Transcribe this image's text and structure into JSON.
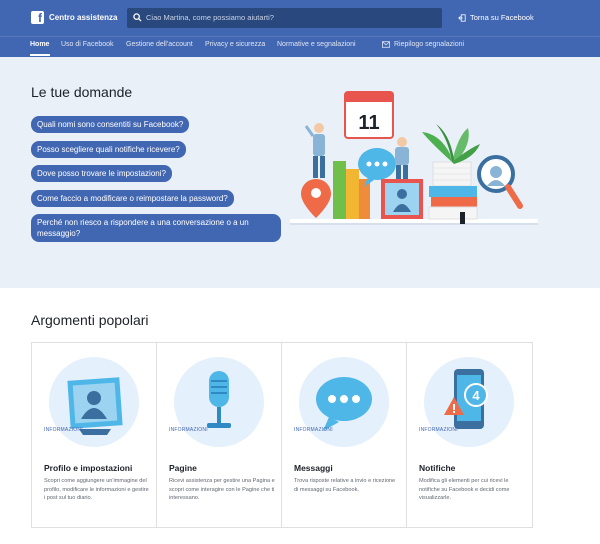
{
  "header": {
    "brand": "Centro assistenza",
    "logo_letter": "f",
    "search_placeholder": "Ciao Martina, come possiamo aiutarti?",
    "back_link": "Torna su Facebook"
  },
  "nav": {
    "items": [
      "Home",
      "Uso di Facebook",
      "Gestione dell'account",
      "Privacy e sicurezza",
      "Normative e segnalazioni"
    ],
    "report_label": "Riepilogo segnalazioni"
  },
  "hero": {
    "title": "Le tue domande",
    "questions": [
      "Quali nomi sono consentiti su Facebook?",
      "Posso scegliere quali notifiche ricevere?",
      "Dove posso trovare le impostazioni?",
      "Come faccio a modificare o reimpostare la password?",
      "Perché non riesco a rispondere a una conversazione o a un messaggio?"
    ],
    "calendar_day": "11"
  },
  "popular": {
    "title": "Argomenti popolari",
    "cards": [
      {
        "category": "INFORMAZIONI",
        "title": "Profilo e impostazioni",
        "description": "Scopri come aggiungere un'immagine del profilo, modificare le informazioni e gestire i post sul tuo diario."
      },
      {
        "category": "INFORMAZIONI",
        "title": "Pagine",
        "description": "Ricevi assistenza per gestire una Pagina e scopri come interagire con le Pagine che ti interessano."
      },
      {
        "category": "INFORMAZIONI",
        "title": "Messaggi",
        "description": "Trova risposte relative a invio e ricezione di messaggi su Facebook."
      },
      {
        "category": "INFORMAZIONI",
        "title": "Notifiche",
        "description": "Modifica gli elementi per cui ricevi le notifiche su Facebook e decidi come visualizzarle."
      }
    ],
    "notification_count": "4"
  },
  "colors": {
    "brand_blue": "#4267b2",
    "hero_bg": "#e9f0f8",
    "accent_light": "#4fb6e8"
  },
  "icons": [
    "search-icon",
    "back-icon",
    "report-icon",
    "calendar-icon",
    "profile-frame-icon",
    "microphone-icon",
    "chat-bubble-icon",
    "phone-notification-icon"
  ]
}
